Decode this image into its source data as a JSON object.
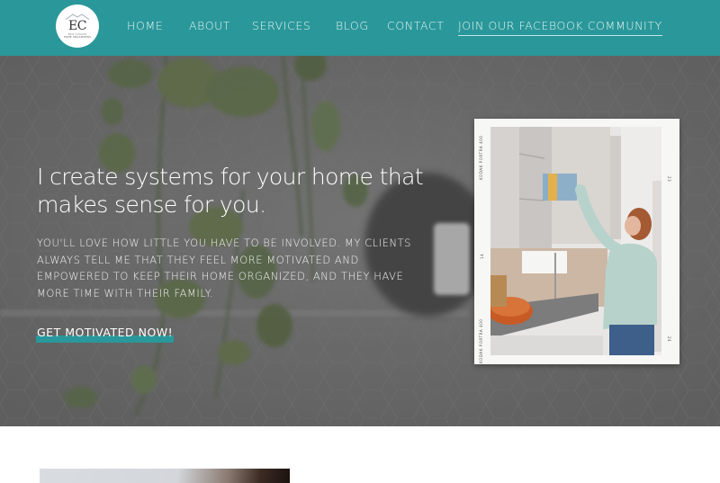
{
  "header": {
    "logo": {
      "monogram": "EC",
      "line1": "ERIN CARLSON",
      "line2": "HOME ORGANIZERS",
      "icon": "house-roof-icon"
    },
    "nav": [
      {
        "label": "HOME"
      },
      {
        "label": "ABOUT"
      },
      {
        "label": "SERVICES"
      },
      {
        "label": "BLOG"
      },
      {
        "label": "CONTACT"
      },
      {
        "label": "JOIN OUR FACEBOOK COMMUNITY"
      }
    ]
  },
  "hero": {
    "headline": "I create systems for your home that makes sense for you.",
    "body": "You'll love how little you have to be involved. My clients always tell me that they feel more motivated and empowered to keep their home organized, and they have more time with their family.",
    "cta_label": "GET MOTIVATED NOW!",
    "photo": {
      "alt": "Woman placing a clear organizer bin into a kitchen cabinet",
      "film_left_top": "KODAK PORTRA 400",
      "film_left_mid": "14",
      "film_left_bottom": "KODAK PORTRA 400",
      "film_right_top": "23",
      "film_right_bottom": "24"
    }
  },
  "colors": {
    "brand_teal": "#2a979a",
    "nav_text": "#e6f6f4",
    "hero_overlay": "#6e6e6e"
  }
}
